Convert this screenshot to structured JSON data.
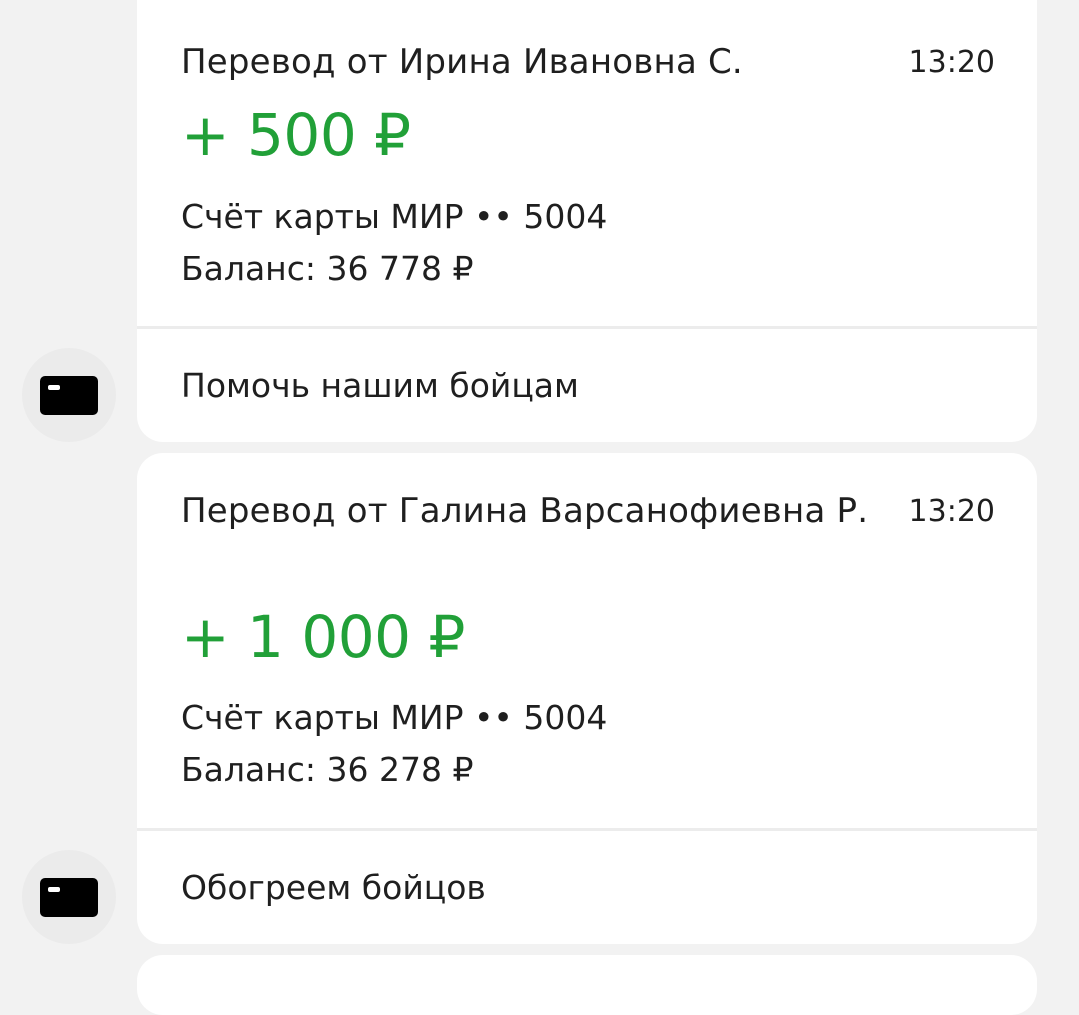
{
  "transactions": [
    {
      "sender": "Перевод от Ирина Ивановна С.",
      "time": "13:20",
      "amount": "+ 500 ₽",
      "account": "Счёт карты МИР •• 5004",
      "balance": "Баланс: 36 778 ₽",
      "purpose": "Помочь нашим бойцам",
      "icon": "bank-card-icon"
    },
    {
      "sender": "Перевод от Галина Варсанофиевна Р.",
      "time": "13:20",
      "amount": "+ 1 000 ₽",
      "account": "Счёт карты МИР •• 5004",
      "balance": "Баланс: 36 278 ₽",
      "purpose": "Обогреем бойцов",
      "icon": "bank-card-icon"
    }
  ],
  "colors": {
    "amount_green": "#21a038",
    "background": "#f2f2f2",
    "card": "#ffffff"
  }
}
